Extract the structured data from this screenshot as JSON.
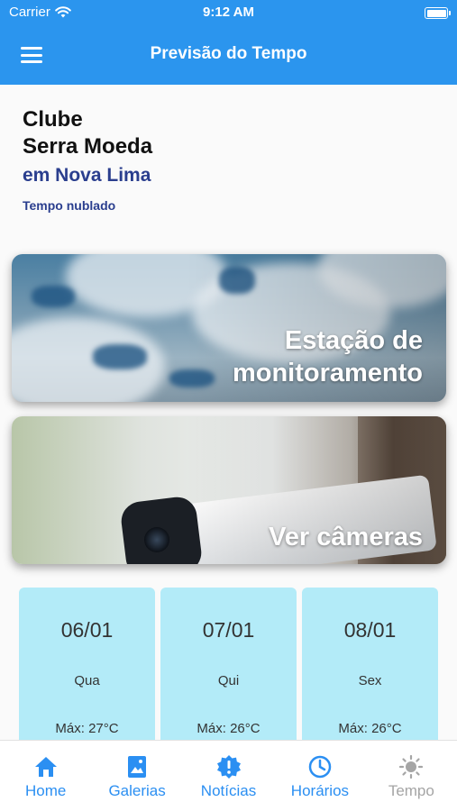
{
  "status_bar": {
    "carrier": "Carrier",
    "time": "9:12 AM",
    "wifi_icon": "wifi-icon",
    "battery_icon": "battery-icon"
  },
  "nav": {
    "title": "Previsão do Tempo",
    "menu_icon": "hamburger-menu-icon"
  },
  "location": {
    "name_line1": "Clube",
    "name_line2": "Serra Moeda",
    "city": "em Nova Lima",
    "condition": "Tempo nublado"
  },
  "cards": [
    {
      "label_line1": "Estação de",
      "label_line2": "monitoramento"
    },
    {
      "label": "Ver câmeras"
    }
  ],
  "forecast": [
    {
      "date": "06/01",
      "weekday": "Qua",
      "max": "Máx: 27°C"
    },
    {
      "date": "07/01",
      "weekday": "Qui",
      "max": "Máx: 26°C"
    },
    {
      "date": "08/01",
      "weekday": "Sex",
      "max": "Máx: 26°C"
    }
  ],
  "tabs": [
    {
      "label": "Home",
      "icon": "home-icon",
      "active": true
    },
    {
      "label": "Galerias",
      "icon": "gallery-icon",
      "active": true
    },
    {
      "label": "Notícias",
      "icon": "news-badge-icon",
      "active": true
    },
    {
      "label": "Horários",
      "icon": "clock-icon",
      "active": true
    },
    {
      "label": "Tempo",
      "icon": "sun-icon",
      "active": false
    }
  ],
  "colors": {
    "primary": "#2b95ee",
    "heading_blue": "#2a3e8e",
    "forecast_card": "#b3ebf8",
    "tab_active": "#2b8ff2",
    "tab_inactive": "#a5a5a5"
  }
}
